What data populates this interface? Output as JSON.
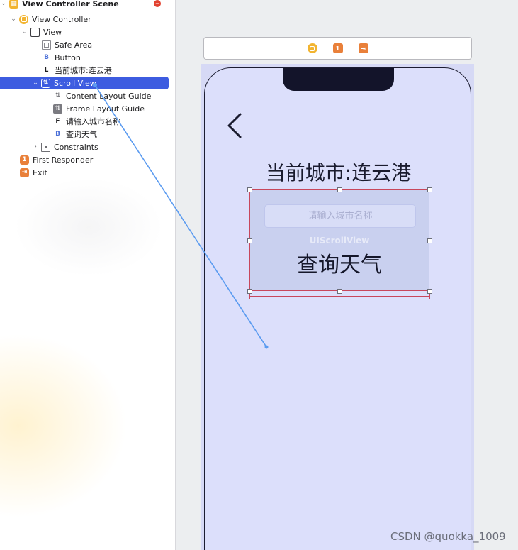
{
  "outline": {
    "items": [
      {
        "label": "View Controller Scene",
        "icon": "scene-icon"
      },
      {
        "label": "View Controller",
        "icon": "view-controller-icon"
      },
      {
        "label": "View",
        "icon": "view-icon"
      },
      {
        "label": "Safe Area",
        "icon": "safe-area-icon"
      },
      {
        "label": "Button",
        "icon": "button-b-icon",
        "glyph": "B"
      },
      {
        "label": "当前城市:连云港",
        "icon": "label-l-icon",
        "glyph": "L"
      },
      {
        "label": "Scroll View",
        "icon": "scroll-view-icon",
        "selected": true
      },
      {
        "label": "Content Layout Guide",
        "icon": "content-layout-guide-icon"
      },
      {
        "label": "Frame Layout Guide",
        "icon": "frame-layout-guide-icon"
      },
      {
        "label": "请输入城市名称",
        "icon": "textfield-f-icon",
        "glyph": "F"
      },
      {
        "label": "查询天气",
        "icon": "button-b-icon",
        "glyph": "B"
      },
      {
        "label": "Constraints",
        "icon": "constraints-icon"
      },
      {
        "label": "First Responder",
        "icon": "first-responder-icon",
        "glyph": "1"
      },
      {
        "label": "Exit",
        "icon": "exit-icon"
      }
    ]
  },
  "canvas": {
    "dock_icons": [
      "view-controller-icon",
      "first-responder-icon",
      "exit-icon"
    ],
    "dock_first_glyph": "1",
    "city_label": "当前城市:连云港",
    "scroll_view_watermark": "UIScrollView",
    "city_input_placeholder": "请输入城市名称",
    "query_button_label": "查询天气"
  },
  "colors": {
    "selection": "#3d5ce0",
    "device_background": "#dcdffb",
    "scroll_view_fill": "#c9d0ef",
    "constraint_red": "#c8475c",
    "connection_blue": "#5b9bf0"
  },
  "watermark": "CSDN @quokka_1009"
}
